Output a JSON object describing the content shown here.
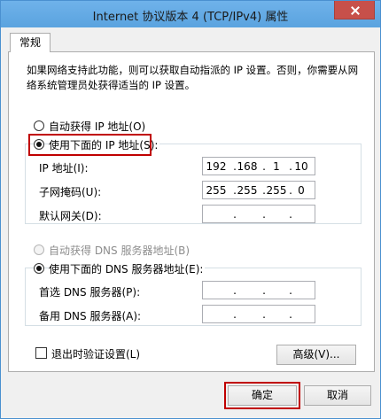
{
  "window": {
    "title": "Internet 协议版本 4 (TCP/IPv4) 属性"
  },
  "tabs": [
    {
      "label": "常规"
    }
  ],
  "description": {
    "line1": "如果网络支持此功能，则可以获取自动指派的 IP 设置。否则，你需要从网",
    "line2": "络系统管理员处获得适当的 IP 设置。"
  },
  "ip_section": {
    "auto_label": "自动获得 IP 地址(O)",
    "manual_label": "使用下面的 IP 地址(S):",
    "selected": "manual",
    "fields": [
      {
        "label": "IP 地址(I):",
        "octets": [
          "192",
          "168",
          "1",
          "10"
        ]
      },
      {
        "label": "子网掩码(U):",
        "octets": [
          "255",
          "255",
          "255",
          "0"
        ]
      },
      {
        "label": "默认网关(D):",
        "octets": [
          "",
          "",
          "",
          ""
        ]
      }
    ]
  },
  "dns_section": {
    "auto_label": "自动获得 DNS 服务器地址(B)",
    "manual_label": "使用下面的 DNS 服务器地址(E):",
    "selected": "manual",
    "fields": [
      {
        "label": "首选 DNS 服务器(P):",
        "octets": [
          "",
          "",
          "",
          ""
        ]
      },
      {
        "label": "备用 DNS 服务器(A):",
        "octets": [
          "",
          "",
          "",
          ""
        ]
      }
    ]
  },
  "validate_checkbox": {
    "label": "退出时验证设置(L)",
    "checked": false
  },
  "buttons": {
    "advanced": "高级(V)...",
    "ok": "确定",
    "cancel": "取消"
  },
  "colors": {
    "titlebar": "#5aa3df",
    "close_button": "#c7504a",
    "highlight_box": "#c00000"
  }
}
